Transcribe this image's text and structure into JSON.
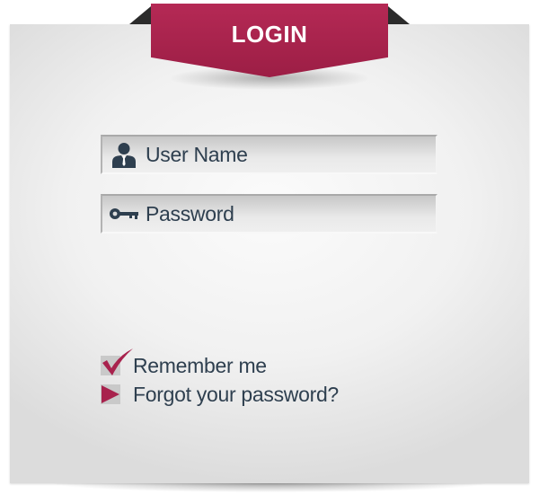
{
  "header": {
    "title": "LOGIN"
  },
  "form": {
    "username": {
      "placeholder": "User Name",
      "value": "",
      "icon": "user-icon"
    },
    "password": {
      "placeholder": "Password",
      "value": "",
      "icon": "key-icon"
    },
    "remember": {
      "label": "Remember me",
      "checked": true
    },
    "forgot": {
      "label": "Forgot your password?"
    }
  },
  "colors": {
    "accent": "#a8224d",
    "text": "#2e3f4f",
    "ribbon_fold": "#2b2b2b"
  }
}
